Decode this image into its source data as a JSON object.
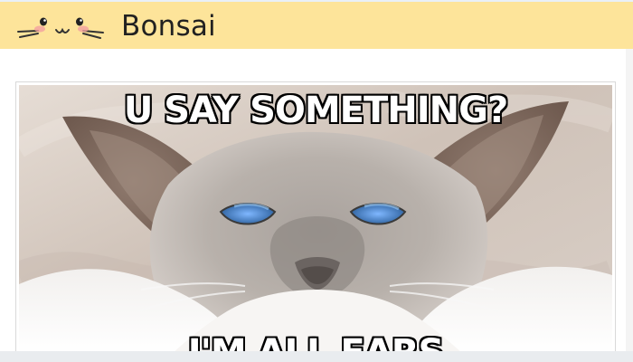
{
  "header": {
    "brand": "Bonsai"
  },
  "meme": {
    "top_text": "U SAY SOMETHING?",
    "bottom_text": "I'M ALL EARS"
  },
  "colors": {
    "header_bg": "#fde49a",
    "page_bg": "#ffffff",
    "meme_text": "#ffffff",
    "meme_outline": "#000000"
  },
  "icons": {
    "logo": "cat-face-logo-icon"
  }
}
